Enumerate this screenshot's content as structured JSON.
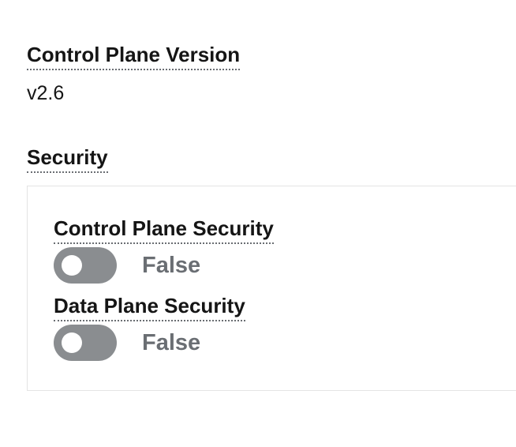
{
  "control_plane_version": {
    "label": "Control Plane Version",
    "value": "v2.6"
  },
  "security": {
    "heading": "Security",
    "control_plane_security": {
      "label": "Control Plane Security",
      "state_text": "False",
      "checked": false
    },
    "data_plane_security": {
      "label": "Data Plane Security",
      "state_text": "False",
      "checked": false
    }
  },
  "colors": {
    "label_underline": "#6a6e73",
    "switch_off_track": "#8a8d90",
    "switch_state_text": "#6a6e73",
    "box_border": "#e4e4e4"
  }
}
